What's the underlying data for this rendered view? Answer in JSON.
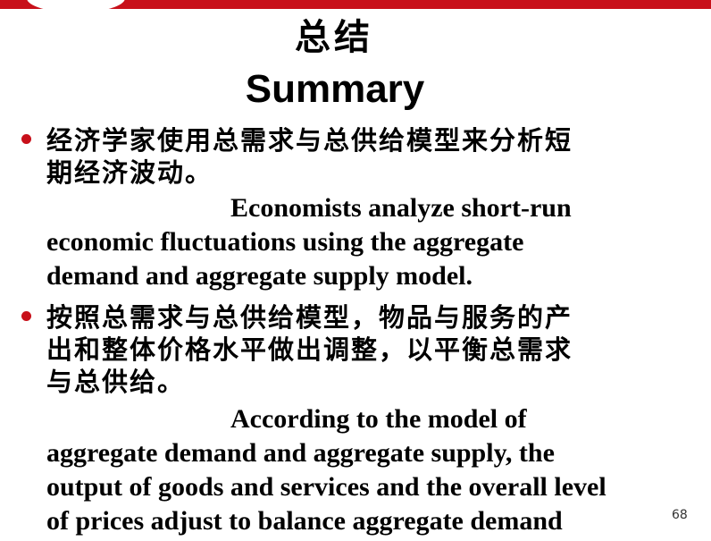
{
  "slide": {
    "title_cn": "总结",
    "title_en": "Summary",
    "page_number": "68"
  },
  "bullets": [
    {
      "cn": "经济学家使用总需求与总供给模型来分析短\n期经济波动。",
      "en_first_line": "Economists analyze short-run",
      "en_rest": "economic fluctuations using the aggregate\ndemand and aggregate supply model."
    },
    {
      "cn": "按照总需求与总供给模型，物品与服务的产\n出和整体价格水平做出调整，以平衡总需求\n与总供给。",
      "en_first_line": "According to the model of",
      "en_rest": "aggregate demand and aggregate supply, the\noutput of goods and services and the overall level\nof prices adjust to balance aggregate demand"
    }
  ],
  "colors": {
    "accent": "#c8101a"
  }
}
